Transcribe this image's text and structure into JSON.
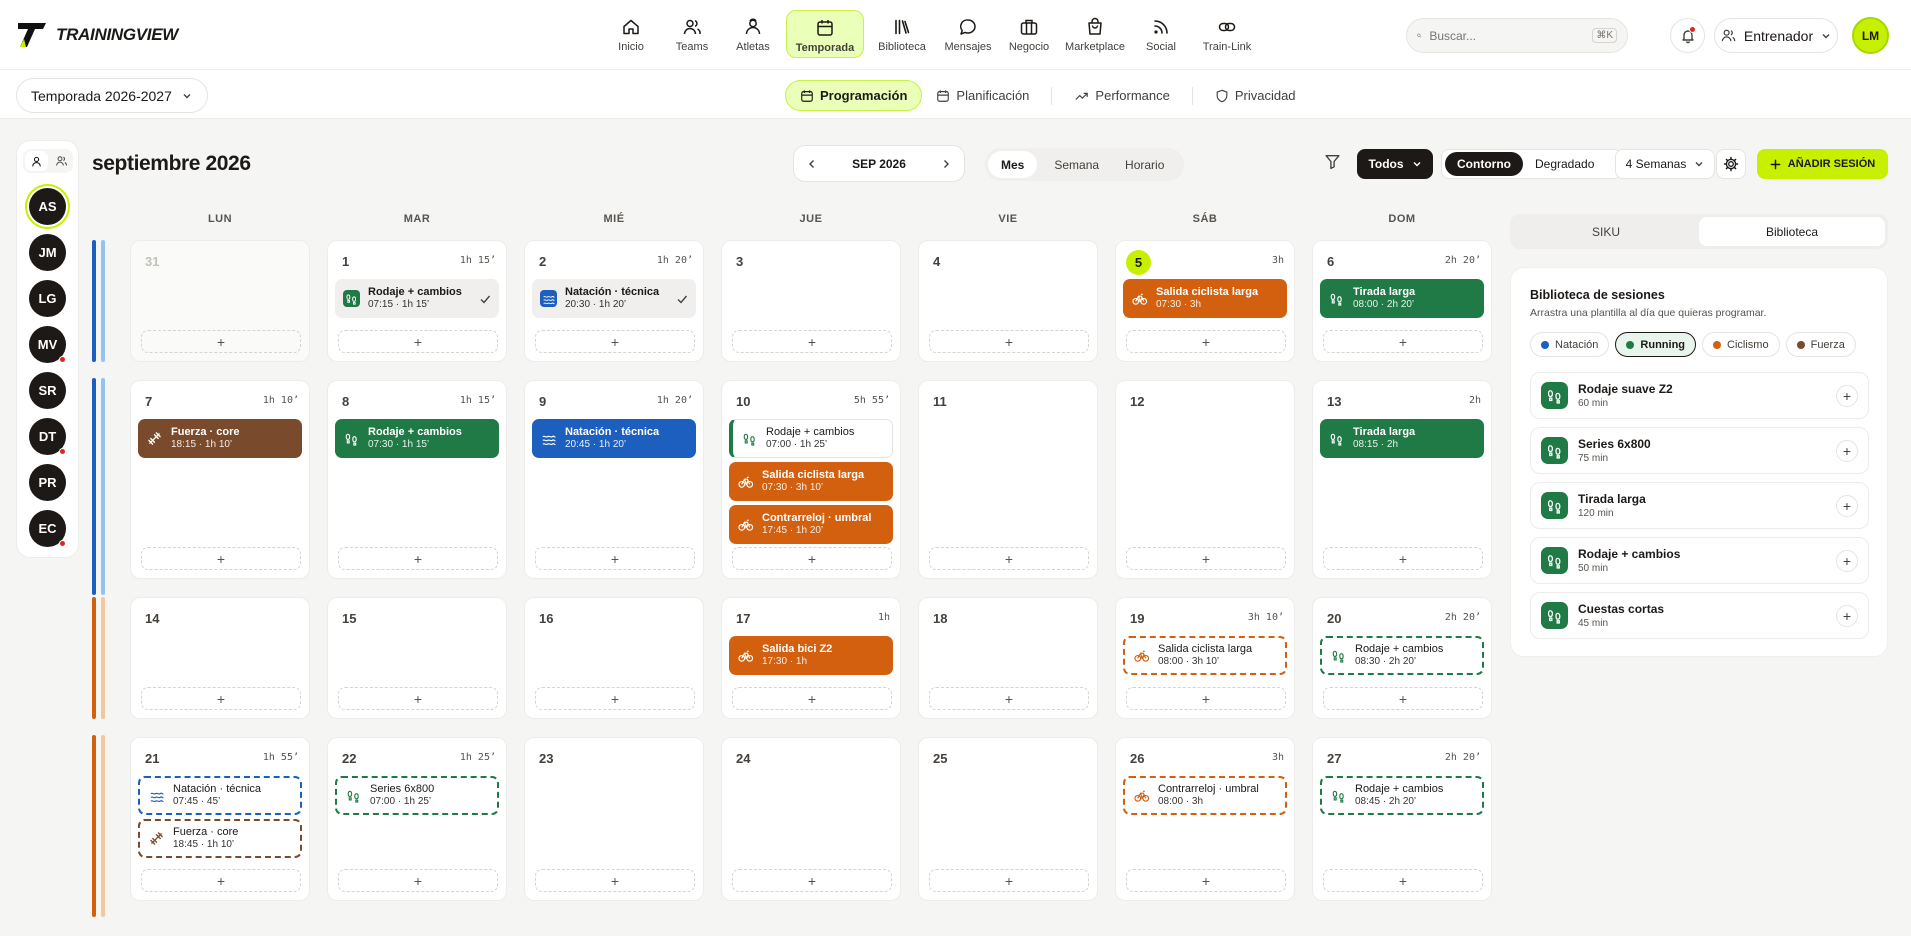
{
  "app": {
    "name": "TRAININGVIEW"
  },
  "nav": [
    {
      "label": "Inicio",
      "icon": "home-icon"
    },
    {
      "label": "Teams",
      "icon": "users-icon"
    },
    {
      "label": "Atletas",
      "icon": "user-icon"
    },
    {
      "label": "Temporada",
      "icon": "calendar-icon",
      "active": true
    },
    {
      "label": "Biblioteca",
      "icon": "library-icon"
    },
    {
      "label": "Mensajes",
      "icon": "message-icon"
    },
    {
      "label": "Negocio",
      "icon": "briefcase-icon"
    },
    {
      "label": "Marketplace",
      "icon": "bag-icon"
    },
    {
      "label": "Social",
      "icon": "rss-icon"
    },
    {
      "label": "Train-Link",
      "icon": "link-icon"
    }
  ],
  "search": {
    "placeholder": "Buscar...",
    "shortcut": "⌘K"
  },
  "role": "Entrenador",
  "user": {
    "initials": "LM"
  },
  "season": "Temporada 2026-2027",
  "subtabs": [
    {
      "label": "Programación",
      "active": true
    },
    {
      "label": "Planificación"
    },
    {
      "label": "Performance"
    },
    {
      "label": "Privacidad"
    }
  ],
  "athletes": [
    {
      "initials": "AS",
      "selected": true,
      "alert": false
    },
    {
      "initials": "JM",
      "alert": false
    },
    {
      "initials": "LG",
      "alert": false
    },
    {
      "initials": "MV",
      "alert": true
    },
    {
      "initials": "SR",
      "alert": false
    },
    {
      "initials": "DT",
      "alert": true
    },
    {
      "initials": "PR",
      "alert": false
    },
    {
      "initials": "EC",
      "alert": true
    }
  ],
  "calendar": {
    "month_title": "septiembre 2026",
    "nav_label": "SEP 2026",
    "views": [
      "Mes",
      "Semana",
      "Horario"
    ],
    "active_view": "Mes",
    "filter": "Todos",
    "styles": [
      "Contorno",
      "Degradado"
    ],
    "active_style": "Contorno",
    "weeks": "4 Semanas",
    "add_label": "AÑADIR SESIÓN",
    "days_of_week": [
      "LUN",
      "MAR",
      "MIÉ",
      "JUE",
      "VIE",
      "SÁB",
      "DOM"
    ]
  },
  "colors": {
    "run": "#1f7a45",
    "swim": "#1d5fbf",
    "bike": "#d2600f",
    "strength": "#7a4a2c",
    "accent": "#c7f000"
  },
  "weeks": [
    {
      "bars": [
        "#93c3f0",
        "#1d5fbf"
      ],
      "days": [
        {
          "num": "31",
          "prev": true,
          "dur": "",
          "events": []
        },
        {
          "num": "1",
          "dur": "1h 15’",
          "events": [
            {
              "title": "Rodaje + cambios",
              "sub": "07:15 · 1h 15’",
              "sport": "run",
              "style": "done"
            }
          ]
        },
        {
          "num": "2",
          "dur": "1h 20’",
          "events": [
            {
              "title": "Natación · técnica",
              "sub": "20:30 · 1h 20’",
              "sport": "swim",
              "style": "done"
            }
          ]
        },
        {
          "num": "3",
          "dur": "",
          "events": []
        },
        {
          "num": "4",
          "dur": "",
          "events": []
        },
        {
          "num": "5",
          "today": true,
          "dur": "3h",
          "events": [
            {
              "title": "Salida ciclista larga",
              "sub": "07:30 · 3h",
              "sport": "bike",
              "style": "solid"
            }
          ]
        },
        {
          "num": "6",
          "dur": "2h 20’",
          "events": [
            {
              "title": "Tirada larga",
              "sub": "08:00 · 2h 20’",
              "sport": "run",
              "style": "solid"
            }
          ]
        }
      ]
    },
    {
      "bars": [
        "#93c3f0",
        "#1d5fbf"
      ],
      "days": [
        {
          "num": "7",
          "dur": "1h 10’",
          "events": [
            {
              "title": "Fuerza · core",
              "sub": "18:15 · 1h 10’",
              "sport": "strength",
              "style": "solid"
            }
          ]
        },
        {
          "num": "8",
          "dur": "1h 15’",
          "events": [
            {
              "title": "Rodaje + cambios",
              "sub": "07:30 · 1h 15’",
              "sport": "run",
              "style": "solid"
            }
          ]
        },
        {
          "num": "9",
          "dur": "1h 20’",
          "events": [
            {
              "title": "Natación · técnica",
              "sub": "20:45 · 1h 20’",
              "sport": "swim",
              "style": "solid"
            }
          ]
        },
        {
          "num": "10",
          "dur": "5h 55’",
          "events": [
            {
              "title": "Rodaje + cambios",
              "sub": "07:00 · 1h 25’",
              "sport": "run",
              "style": "left"
            },
            {
              "title": "Salida ciclista larga",
              "sub": "07:30 · 3h 10’",
              "sport": "bike",
              "style": "solid"
            },
            {
              "title": "Contrarreloj · umbral",
              "sub": "17:45 · 1h 20’",
              "sport": "bike",
              "style": "solid"
            }
          ]
        },
        {
          "num": "11",
          "dur": "",
          "events": []
        },
        {
          "num": "12",
          "dur": "",
          "events": []
        },
        {
          "num": "13",
          "dur": "2h",
          "events": [
            {
              "title": "Tirada larga",
              "sub": "08:15 · 2h",
              "sport": "run",
              "style": "solid"
            }
          ]
        }
      ]
    },
    {
      "bars": [
        "#f5c6a0",
        "#d2600f"
      ],
      "days": [
        {
          "num": "14",
          "dur": "",
          "events": []
        },
        {
          "num": "15",
          "dur": "",
          "events": []
        },
        {
          "num": "16",
          "dur": "",
          "events": []
        },
        {
          "num": "17",
          "dur": "1h",
          "events": [
            {
              "title": "Salida bici Z2",
              "sub": "17:30 · 1h",
              "sport": "bike",
              "style": "solid"
            }
          ]
        },
        {
          "num": "18",
          "dur": "",
          "events": []
        },
        {
          "num": "19",
          "dur": "3h 10’",
          "events": [
            {
              "title": "Salida ciclista larga",
              "sub": "08:00 · 3h 10’",
              "sport": "bike",
              "style": "outline"
            }
          ]
        },
        {
          "num": "20",
          "dur": "2h 20’",
          "events": [
            {
              "title": "Rodaje + cambios",
              "sub": "08:30 · 2h 20’",
              "sport": "run",
              "style": "outline"
            }
          ]
        }
      ]
    },
    {
      "bars": [
        "#f5c6a0",
        "#d2600f"
      ],
      "days": [
        {
          "num": "21",
          "dur": "1h 55’",
          "events": [
            {
              "title": "Natación · técnica",
              "sub": "07:45 · 45’",
              "sport": "swim",
              "style": "outline"
            },
            {
              "title": "Fuerza · core",
              "sub": "18:45 · 1h 10’",
              "sport": "strength",
              "style": "outline"
            }
          ]
        },
        {
          "num": "22",
          "dur": "1h 25’",
          "events": [
            {
              "title": "Series 6x800",
              "sub": "07:00 · 1h 25’",
              "sport": "run",
              "style": "outline"
            }
          ]
        },
        {
          "num": "23",
          "dur": "",
          "events": []
        },
        {
          "num": "24",
          "dur": "",
          "events": []
        },
        {
          "num": "25",
          "dur": "",
          "events": []
        },
        {
          "num": "26",
          "dur": "3h",
          "events": [
            {
              "title": "Contrarreloj · umbral",
              "sub": "08:00 · 3h",
              "sport": "bike",
              "style": "outline"
            }
          ]
        },
        {
          "num": "27",
          "dur": "2h 20’",
          "events": [
            {
              "title": "Rodaje + cambios",
              "sub": "08:45 · 2h 20’",
              "sport": "run",
              "style": "outline"
            }
          ]
        }
      ]
    }
  ],
  "side": {
    "tabs": [
      "SIKU",
      "Biblioteca"
    ],
    "active_tab": "Biblioteca",
    "title": "Biblioteca de sesiones",
    "subtitle": "Arrastra una plantilla al día que quieras programar.",
    "chips": [
      {
        "label": "Natación",
        "color": "#1d5fbf"
      },
      {
        "label": "Running",
        "color": "#1f7a45",
        "active": true
      },
      {
        "label": "Ciclismo",
        "color": "#d2600f"
      },
      {
        "label": "Fuerza",
        "color": "#7a4a2c"
      }
    ],
    "items": [
      {
        "title": "Rodaje suave Z2",
        "sub": "60 min"
      },
      {
        "title": "Series 6x800",
        "sub": "75 min"
      },
      {
        "title": "Tirada larga",
        "sub": "120 min"
      },
      {
        "title": "Rodaje + cambios",
        "sub": "50 min"
      },
      {
        "title": "Cuestas cortas",
        "sub": "45 min"
      }
    ]
  }
}
